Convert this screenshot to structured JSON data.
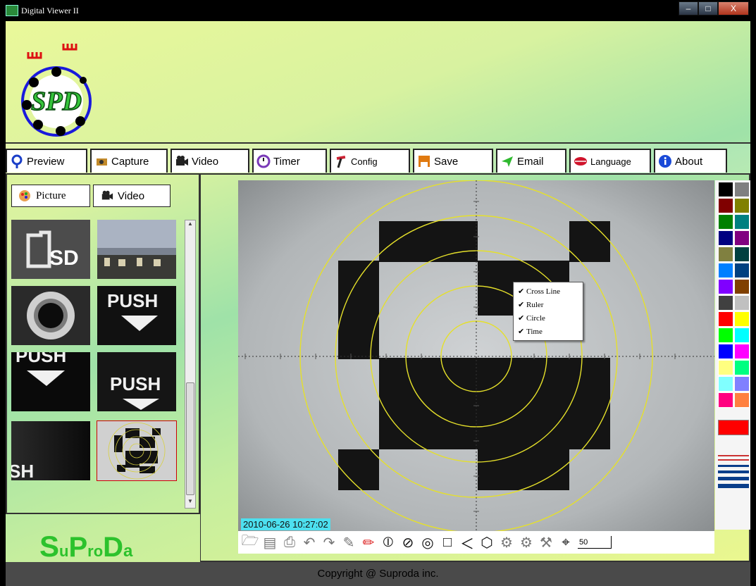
{
  "window": {
    "title": "Digital Viewer II",
    "controls": [
      "–",
      "□",
      "X"
    ]
  },
  "toolbar": {
    "tabs": [
      {
        "label": "Preview",
        "icon": "pin-icon"
      },
      {
        "label": "Capture",
        "icon": "camera-icon"
      },
      {
        "label": "Video",
        "icon": "video-camera-icon"
      },
      {
        "label": "Timer",
        "icon": "clock-icon"
      },
      {
        "label": "Config",
        "icon": "hammer-icon"
      },
      {
        "label": "Save",
        "icon": "floppy-icon"
      },
      {
        "label": "Email",
        "icon": "send-icon"
      },
      {
        "label": "Language",
        "icon": "lips-icon"
      },
      {
        "label": "About",
        "icon": "info-icon"
      }
    ]
  },
  "library": {
    "tabs": [
      {
        "label": "Picture",
        "icon": "picture-icon"
      },
      {
        "label": "Video",
        "icon": "video-camera-icon"
      }
    ]
  },
  "thumbnails": {
    "t1": "SD",
    "t3": "PUSH",
    "t5": "PUSH",
    "t6": "PUSH",
    "t7": "SH"
  },
  "logo": {
    "letters": "SPD"
  },
  "brand": {
    "S": "S",
    "u": "u",
    "P": "P",
    "ro": "ro",
    "D": "D",
    "a": "a"
  },
  "viewer": {
    "timestamp": "2010-06-26 10:27:02",
    "context_menu": [
      "Cross Line",
      "Ruler",
      "Circle",
      "Time"
    ],
    "line_width": "50"
  },
  "palette": {
    "colors": [
      "#000000",
      "#808080",
      "#800000",
      "#808000",
      "#008000",
      "#008080",
      "#000080",
      "#800080",
      "#808040",
      "#004040",
      "#0080ff",
      "#004080",
      "#8000ff",
      "#804000",
      "#404040",
      "#c0c0c0",
      "#ff0000",
      "#ffff00",
      "#00ff00",
      "#00ffff",
      "#0000ff",
      "#ff00ff",
      "#ffff80",
      "#00ff80",
      "#80ffff",
      "#8080ff",
      "#ff0080",
      "#ff8040"
    ],
    "selected": "#ff0000"
  },
  "footer": {
    "copyright": "Copyright @ Suproda inc."
  }
}
